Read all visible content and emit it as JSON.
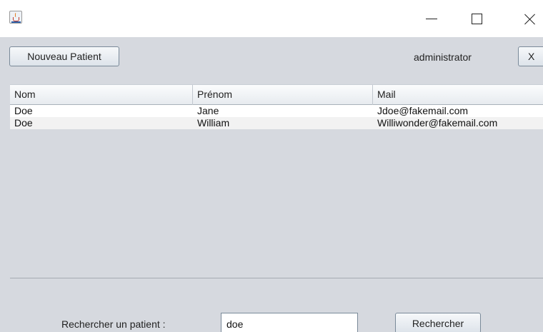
{
  "window": {
    "app_icon": "java-cup-icon",
    "controls": [
      "minimize-icon",
      "maximize-icon",
      "close-icon"
    ]
  },
  "toolbar": {
    "new_patient_label": "Nouveau Patient",
    "user_name": "administrator",
    "logout_label": "X"
  },
  "table": {
    "columns": [
      "Nom",
      "Prénom",
      "Mail"
    ],
    "rows": [
      [
        "Doe",
        "Jane",
        "Jdoe@fakemail.com"
      ],
      [
        "Doe",
        "William",
        "Williwonder@fakemail.com"
      ]
    ]
  },
  "search": {
    "label": "Rechercher un patient :",
    "value": "doe",
    "button_label": "Rechercher"
  }
}
